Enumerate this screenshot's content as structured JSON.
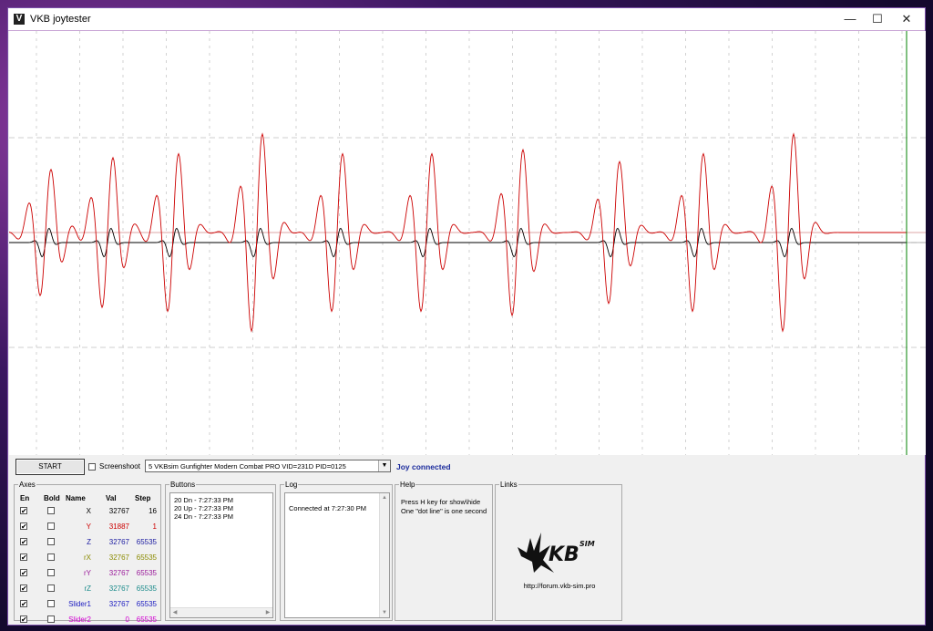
{
  "window": {
    "title": "VKB joytester",
    "icon_letter": "V",
    "controls": {
      "minimize": "—",
      "maximize": "☐",
      "close": "✕"
    }
  },
  "toolbar": {
    "start_label": "START",
    "screenshoot_label": "Screenshoot",
    "screenshoot_checked": false,
    "device_selected": "5 VKBsim Gunfighter Modern Combat PRO  VID=231D PID=0125",
    "status": "Joy connected"
  },
  "axes": {
    "group_label": "Axes",
    "headers": {
      "en": "En",
      "bold": "Bold",
      "name": "Name",
      "val": "Val",
      "step": "Step"
    },
    "rows": [
      {
        "name": "X",
        "val": "32767",
        "step": "16",
        "color": "#000000",
        "en": true,
        "bold": false
      },
      {
        "name": "Y",
        "val": "31887",
        "step": "1",
        "color": "#cc0000",
        "en": true,
        "bold": false
      },
      {
        "name": "Z",
        "val": "32767",
        "step": "65535",
        "color": "#1a1aa0",
        "en": true,
        "bold": false
      },
      {
        "name": "rX",
        "val": "32767",
        "step": "65535",
        "color": "#8a8a00",
        "en": true,
        "bold": false
      },
      {
        "name": "rY",
        "val": "32767",
        "step": "65535",
        "color": "#9a1a9a",
        "en": true,
        "bold": false
      },
      {
        "name": "rZ",
        "val": "32767",
        "step": "65535",
        "color": "#1a8a8a",
        "en": true,
        "bold": false
      },
      {
        "name": "Slider1",
        "val": "32767",
        "step": "65535",
        "color": "#1a1ac0",
        "en": true,
        "bold": false
      },
      {
        "name": "Slider2",
        "val": "0",
        "step": "65535",
        "color": "#d000d0",
        "en": true,
        "bold": false
      }
    ]
  },
  "buttons": {
    "group_label": "Buttons",
    "items": [
      "20 Dn - 7:27:33 PM",
      "20 Up - 7:27:33 PM",
      "24 Dn - 7:27:33 PM"
    ]
  },
  "log": {
    "group_label": "Log",
    "items": [
      "Connected at 7:27:30 PM"
    ]
  },
  "help": {
    "group_label": "Help",
    "line1": "Press H key for show\\hide",
    "line2": "One \"dot line\" is one second"
  },
  "links": {
    "group_label": "Links",
    "logo_text": "KB",
    "logo_sup": "SIM",
    "url": "http://forum.vkb-sim.pro"
  },
  "colors": {
    "x_trace": "#000000",
    "y_trace": "#cc0000",
    "cursor_line": "#008000",
    "status_text": "#1a2a9c"
  }
}
